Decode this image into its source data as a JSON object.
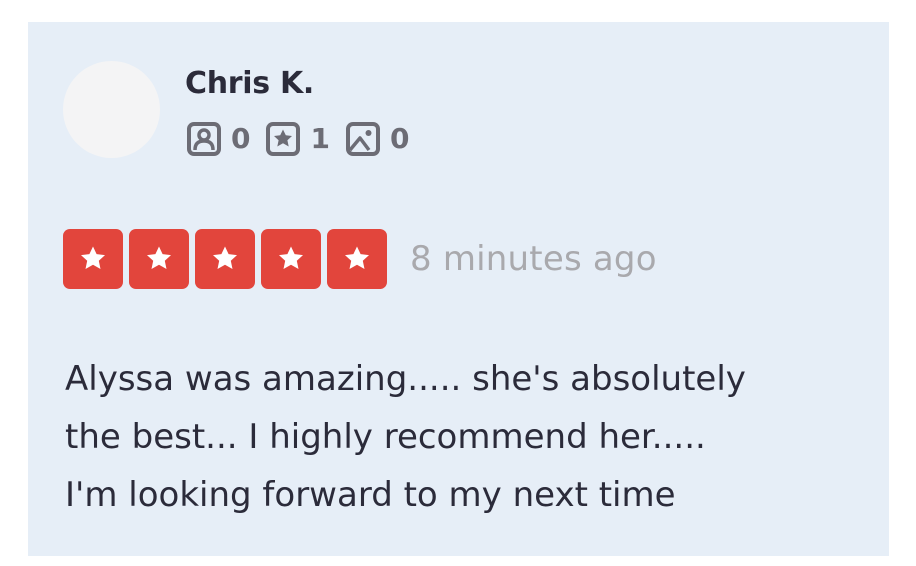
{
  "reviewer": {
    "name": "Chris K.",
    "stats": [
      {
        "icon": "friends-icon",
        "count": "0"
      },
      {
        "icon": "reviews-icon",
        "count": "1"
      },
      {
        "icon": "photos-icon",
        "count": "0"
      }
    ]
  },
  "rating": {
    "stars": 5,
    "max_stars": 5,
    "time_ago": "8 minutes ago",
    "star_color": "#e2453c"
  },
  "review": {
    "text": "Alyssa was amazing..... she's absolutely\nthe best... I highly recommend her.....\nI'm looking forward to my next time"
  },
  "colors": {
    "card_background": "#e6eef7",
    "avatar_background": "#f4f4f5",
    "text": "#2b2b3a",
    "muted_text": "#a9a9ad",
    "icon": "#6c6c75"
  }
}
